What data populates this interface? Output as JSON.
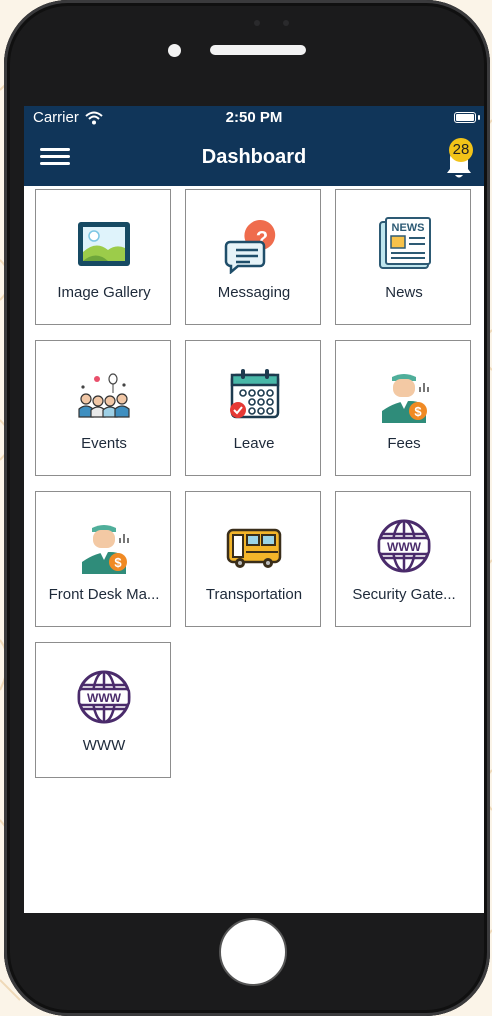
{
  "status_bar": {
    "carrier": "Carrier",
    "time": "2:50 PM"
  },
  "nav": {
    "title": "Dashboard",
    "notification_count": "28"
  },
  "tiles": [
    {
      "label": "Image Gallery",
      "icon": "image-gallery-icon"
    },
    {
      "label": "Messaging",
      "icon": "messaging-icon"
    },
    {
      "label": "News",
      "icon": "news-icon"
    },
    {
      "label": "Events",
      "icon": "events-icon"
    },
    {
      "label": "Leave",
      "icon": "leave-calendar-icon"
    },
    {
      "label": "Fees",
      "icon": "fees-icon"
    },
    {
      "label": "Front Desk Ma...",
      "icon": "front-desk-icon"
    },
    {
      "label": "Transportation",
      "icon": "bus-icon"
    },
    {
      "label": "Security Gate...",
      "icon": "globe-www-icon"
    },
    {
      "label": "WWW",
      "icon": "globe-www-icon"
    }
  ],
  "icons": {
    "news_text": "NEWS",
    "www_text": "WWW"
  },
  "colors": {
    "nav_bg": "#103559",
    "badge": "#f2c318",
    "tile_border": "#8d8d8d"
  }
}
